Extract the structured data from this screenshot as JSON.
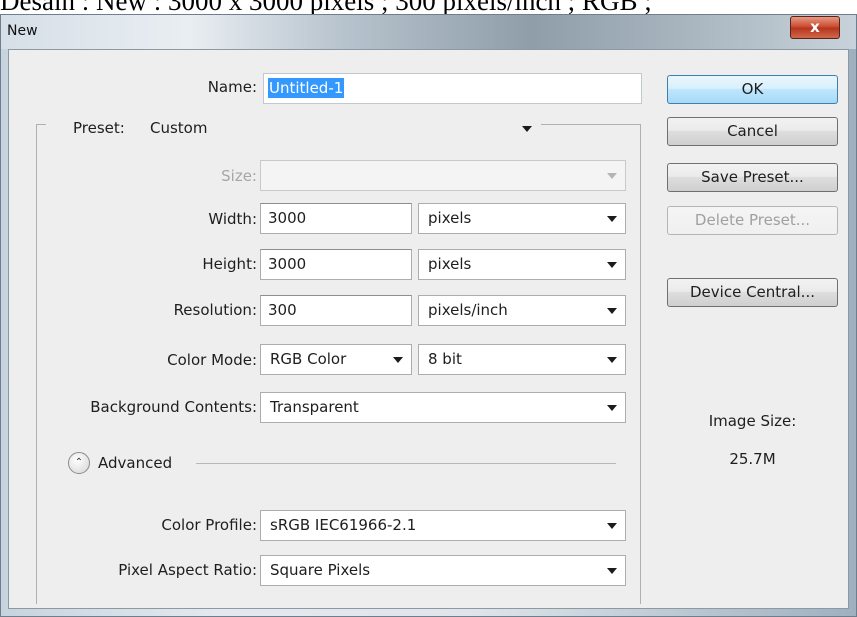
{
  "caption": "Desain : New : 3000 x 3000 pixels ; 300 pixels/inch ; RGB ;",
  "window": {
    "title": "New",
    "close_glyph": "x"
  },
  "name": {
    "label": "Name:",
    "value": "Untitled-1"
  },
  "preset": {
    "label": "Preset:",
    "value": "Custom"
  },
  "size": {
    "label": "Size:",
    "value": ""
  },
  "width": {
    "label": "Width:",
    "value": "3000",
    "unit": "pixels"
  },
  "height": {
    "label": "Height:",
    "value": "3000",
    "unit": "pixels"
  },
  "resolution": {
    "label": "Resolution:",
    "value": "300",
    "unit": "pixels/inch"
  },
  "color_mode": {
    "label": "Color Mode:",
    "value": "RGB Color",
    "depth": "8 bit"
  },
  "background": {
    "label": "Background Contents:",
    "value": "Transparent"
  },
  "advanced": {
    "label": "Advanced",
    "icon": "chevron-up-double-icon"
  },
  "color_profile": {
    "label": "Color Profile:",
    "value": "sRGB IEC61966-2.1"
  },
  "pixel_aspect": {
    "label": "Pixel Aspect Ratio:",
    "value": "Square Pixels"
  },
  "buttons": {
    "ok": "OK",
    "cancel": "Cancel",
    "save_preset": "Save Preset...",
    "delete_preset": "Delete Preset...",
    "device_central": "Device Central..."
  },
  "image_size": {
    "label": "Image Size:",
    "value": "25.7M"
  }
}
